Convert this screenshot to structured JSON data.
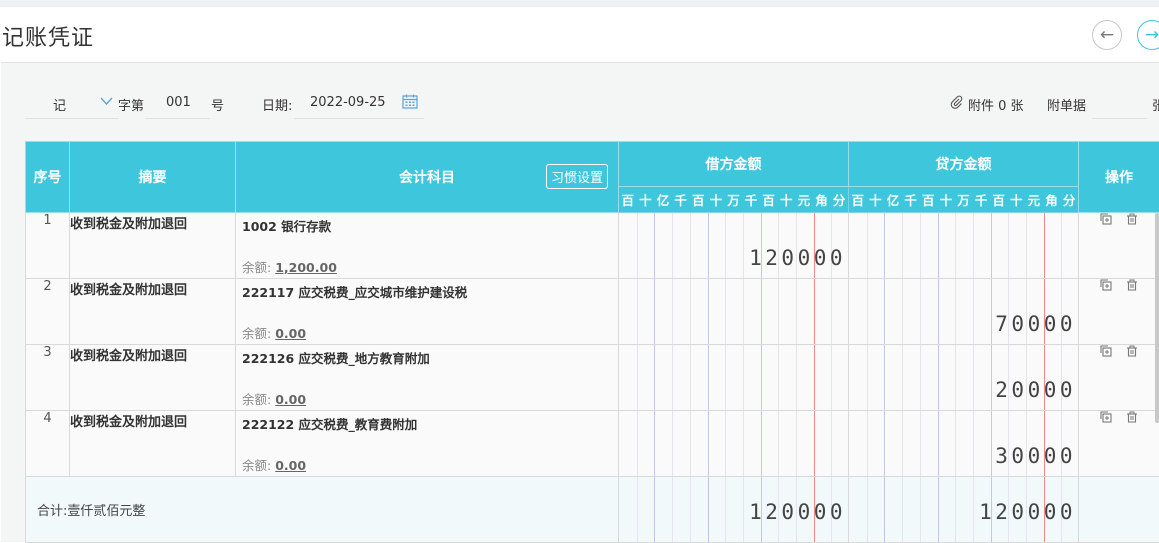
{
  "page": {
    "title": "记账凭证"
  },
  "voucher_header": {
    "type": "记",
    "zi_label": "字第",
    "number": "001",
    "hao_label": "号",
    "date_label": "日期:",
    "date_value": "2022-09-25",
    "attachment_text": "附件 0 张",
    "attach_doc_label": "附单据",
    "zhang_cut": "张"
  },
  "table": {
    "col_seq": "序号",
    "col_summary": "摘要",
    "col_subject": "会计科目",
    "habit_button": "习惯设置",
    "col_debit": "借方金额",
    "col_credit": "贷方金额",
    "col_ops": "操作",
    "digit_units": [
      "百",
      "十",
      "亿",
      "千",
      "百",
      "十",
      "万",
      "千",
      "百",
      "十",
      "元",
      "角",
      "分"
    ],
    "balance_label": "余额:",
    "rows": [
      {
        "seq": "1",
        "summary": "收到税金及附加退回",
        "subject": "1002 银行存款",
        "balance": "1,200.00",
        "debit": "120000",
        "credit": ""
      },
      {
        "seq": "2",
        "summary": "收到税金及附加退回",
        "subject": "222117 应交税费_应交城市维护建设税",
        "balance": "0.00",
        "debit": "",
        "credit": "70000"
      },
      {
        "seq": "3",
        "summary": "收到税金及附加退回",
        "subject": "222126 应交税费_地方教育附加",
        "balance": "0.00",
        "debit": "",
        "credit": "20000"
      },
      {
        "seq": "4",
        "summary": "收到税金及附加退回",
        "subject": "222122 应交税费_教育费附加",
        "balance": "0.00",
        "debit": "",
        "credit": "30000"
      }
    ],
    "total_label": "合计:壹仟贰佰元整",
    "total_debit": "120000",
    "total_credit": "120000"
  },
  "colors": {
    "header_bg": "#3ec6dd",
    "accent": "#3cc4de",
    "cent_line": "#ef8a8a"
  },
  "icons": {
    "prev": "arrow-left-icon",
    "next": "arrow-right-icon",
    "calendar": "calendar-icon",
    "attachment": "paperclip-icon",
    "copy": "copy-row-icon",
    "delete": "trash-icon"
  }
}
